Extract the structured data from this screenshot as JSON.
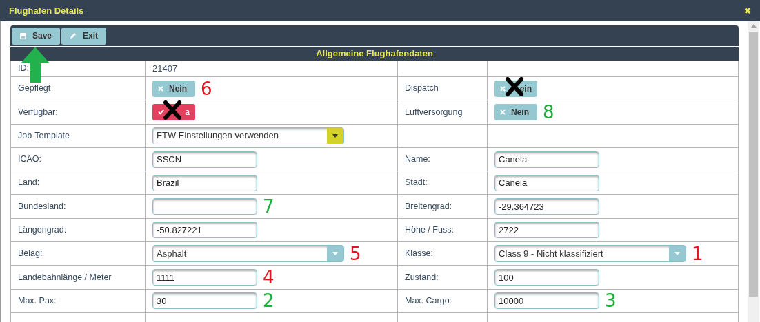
{
  "window": {
    "title": "Flughafen Details",
    "close": "✖"
  },
  "toolbar": [
    {
      "label": "Save",
      "pointer_arrow": true
    },
    {
      "label": "Exit",
      "pointer_arrow": false
    }
  ],
  "section": {
    "title": "Allgemeine Flughafendaten"
  },
  "rows": [
    {
      "left": {
        "label": "ID:",
        "field": {
          "kind": "text",
          "value": "21407"
        }
      },
      "right": {
        "field": {
          "kind": "empty"
        }
      }
    },
    {
      "left": {
        "label": "Gepflegt",
        "field": {
          "kind": "toggle",
          "on": false,
          "label": "Nein",
          "crossed": false,
          "marker": {
            "text": "6",
            "color": "#e8101c"
          }
        }
      },
      "right": {
        "label": "Dispatch",
        "field": {
          "kind": "toggle",
          "on": false,
          "label": "ein",
          "crossed": true
        }
      }
    },
    {
      "left": {
        "label": "Verfügbar:",
        "field": {
          "kind": "toggle",
          "on": true,
          "label": "a",
          "crossed": true
        }
      },
      "right": {
        "label": "Luftversorgung",
        "field": {
          "kind": "toggle",
          "on": false,
          "label": "Nein",
          "crossed": false,
          "marker": {
            "text": "8",
            "color": "#1fae3c"
          }
        }
      }
    },
    {
      "left": {
        "label": "Job-Template",
        "field": {
          "kind": "select",
          "value": "FTW Einstellungen verwenden",
          "highlighted": true
        }
      },
      "right": {
        "field": {
          "kind": "empty"
        }
      }
    },
    {
      "left": {
        "label": "ICAO:",
        "field": {
          "kind": "input",
          "value": "SSCN"
        }
      },
      "right": {
        "label": "Name:",
        "field": {
          "kind": "input",
          "value": "Canela"
        }
      }
    },
    {
      "left": {
        "label": "Land:",
        "field": {
          "kind": "input",
          "value": "Brazil"
        }
      },
      "right": {
        "label": "Stadt:",
        "field": {
          "kind": "input",
          "value": "Canela"
        }
      }
    },
    {
      "left": {
        "label": "Bundesland:",
        "field": {
          "kind": "input",
          "marker": {
            "text": "7",
            "color": "#1fae3c"
          }
        }
      },
      "right": {
        "label": "Breitengrad:",
        "field": {
          "kind": "input",
          "value": "-29.364723"
        }
      }
    },
    {
      "left": {
        "label": "Längengrad:",
        "field": {
          "kind": "input",
          "value": "-50.827221"
        }
      },
      "right": {
        "label": "Höhe / Fuss:",
        "field": {
          "kind": "input",
          "value": "2722"
        }
      }
    },
    {
      "left": {
        "label": "Belag:",
        "field": {
          "kind": "select",
          "value": "Asphalt",
          "highlighted": false,
          "marker": {
            "text": "5",
            "color": "#e8101c"
          }
        }
      },
      "right": {
        "label": "Klasse:",
        "field": {
          "kind": "select",
          "value": "Class 9 - Nicht klassifiziert",
          "highlighted": false,
          "marker": {
            "text": "1",
            "color": "#e8101c"
          }
        }
      }
    },
    {
      "left": {
        "label": "Landebahnlänge / Meter",
        "field": {
          "kind": "input",
          "value": "1111",
          "marker": {
            "text": "4",
            "color": "#e8101c"
          }
        }
      },
      "right": {
        "label": "Zustand:",
        "field": {
          "kind": "input",
          "value": "100"
        }
      }
    },
    {
      "left": {
        "label": "Max. Pax:",
        "field": {
          "kind": "input",
          "value": "30",
          "marker": {
            "text": "2",
            "color": "#1fae3c"
          }
        }
      },
      "right": {
        "label": "Max. Cargo:",
        "field": {
          "kind": "input",
          "value": "10000",
          "marker": {
            "text": "3",
            "color": "#1fae3c"
          }
        }
      }
    }
  ]
}
